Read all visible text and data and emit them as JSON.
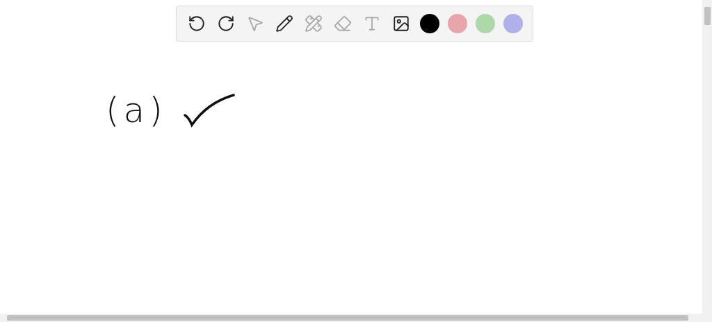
{
  "toolbar": {
    "tools": [
      {
        "kind": "undo",
        "disabled": false
      },
      {
        "kind": "redo",
        "disabled": false
      },
      {
        "kind": "select",
        "disabled": true
      },
      {
        "kind": "pen",
        "disabled": false
      },
      {
        "kind": "tools",
        "disabled": true
      },
      {
        "kind": "eraser",
        "disabled": true
      },
      {
        "kind": "text",
        "disabled": true
      },
      {
        "kind": "image",
        "disabled": false
      }
    ],
    "colors": [
      {
        "color": "#000000"
      },
      {
        "color": "#e8a5ab"
      },
      {
        "color": "#aed8a9"
      },
      {
        "color": "#b0b0ea"
      }
    ]
  },
  "canvas": {
    "label": "(a)"
  }
}
